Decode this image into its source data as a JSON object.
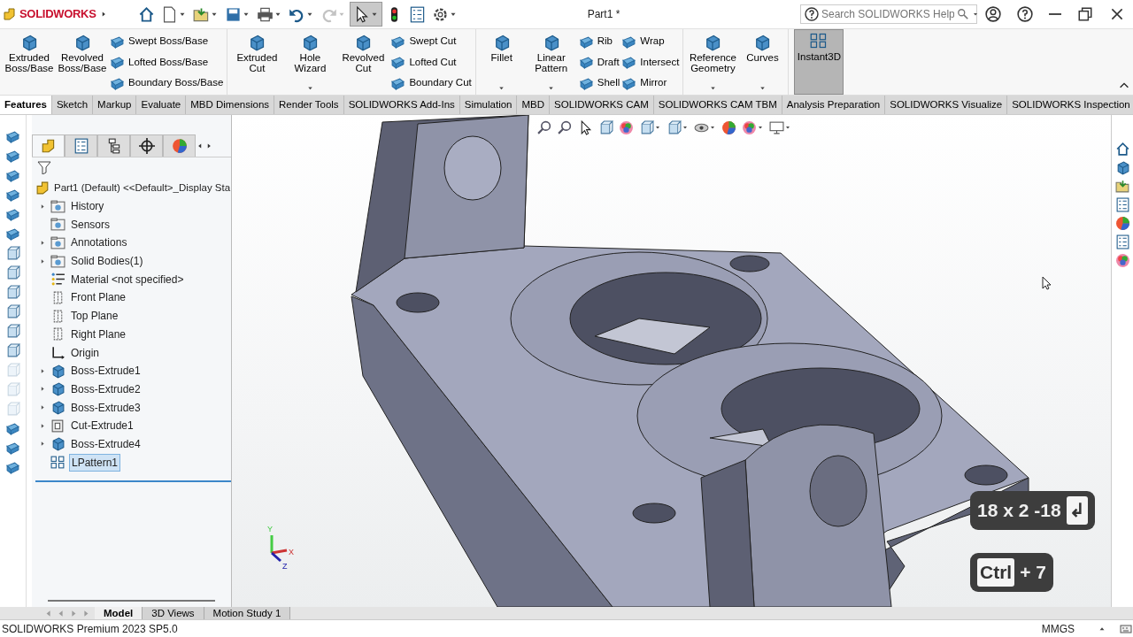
{
  "title_bar": {
    "logo": "SOLIDWORKS",
    "document_title": "Part1 *",
    "search": {
      "placeholder": "Search SOLIDWORKS Help"
    }
  },
  "quick_access": [
    {
      "kind": "home",
      "dropdown": false,
      "active": false,
      "disabled": false
    },
    {
      "kind": "new",
      "dropdown": true,
      "active": false,
      "disabled": false
    },
    {
      "kind": "open",
      "dropdown": true,
      "active": false,
      "disabled": false
    },
    {
      "kind": "save",
      "dropdown": true,
      "active": false,
      "disabled": false
    },
    {
      "kind": "print",
      "dropdown": true,
      "active": false,
      "disabled": false
    },
    {
      "kind": "undo",
      "dropdown": true,
      "active": false,
      "disabled": false
    },
    {
      "kind": "redo",
      "dropdown": true,
      "active": false,
      "disabled": true
    },
    {
      "kind": "select",
      "dropdown": true,
      "active": true,
      "disabled": false
    },
    {
      "kind": "rebuild",
      "dropdown": false,
      "active": false,
      "disabled": false
    },
    {
      "kind": "list",
      "dropdown": false,
      "active": false,
      "disabled": false
    },
    {
      "kind": "gear",
      "dropdown": true,
      "active": false,
      "disabled": false
    }
  ],
  "ribbon": {
    "groups": [
      {
        "columns": [
          {
            "kind": "large",
            "label": "Extruded Boss/Base",
            "dropdown": false
          },
          {
            "kind": "large",
            "label": "Revolved Boss/Base",
            "dropdown": false
          },
          {
            "kind": "stack",
            "items": [
              "Swept Boss/Base",
              "Lofted Boss/Base",
              "Boundary Boss/Base"
            ]
          }
        ]
      },
      {
        "columns": [
          {
            "kind": "large",
            "label": "Extruded Cut",
            "dropdown": false
          },
          {
            "kind": "large",
            "label": "Hole Wizard",
            "dropdown": true
          },
          {
            "kind": "large",
            "label": "Revolved Cut",
            "dropdown": false
          },
          {
            "kind": "stack",
            "items": [
              "Swept Cut",
              "Lofted Cut",
              "Boundary Cut"
            ]
          }
        ]
      },
      {
        "columns": [
          {
            "kind": "large",
            "label": "Fillet",
            "dropdown": true
          },
          {
            "kind": "large",
            "label": "Linear Pattern",
            "dropdown": true
          },
          {
            "kind": "stack",
            "items": [
              "Rib",
              "Draft",
              "Shell"
            ]
          },
          {
            "kind": "stack",
            "items": [
              "Wrap",
              "Intersect",
              "Mirror"
            ]
          }
        ]
      },
      {
        "columns": [
          {
            "kind": "large",
            "label": "Reference Geometry",
            "dropdown": true
          },
          {
            "kind": "large",
            "label": "Curves",
            "dropdown": true
          }
        ]
      }
    ],
    "toggle": {
      "label": "Instant3D",
      "on": true
    }
  },
  "tabs": [
    {
      "label": "Features",
      "selected": true
    },
    {
      "label": "Sketch",
      "selected": false
    },
    {
      "label": "Markup",
      "selected": false
    },
    {
      "label": "Evaluate",
      "selected": false
    },
    {
      "label": "MBD Dimensions",
      "selected": false
    },
    {
      "label": "Render Tools",
      "selected": false
    },
    {
      "label": "SOLIDWORKS Add-Ins",
      "selected": false
    },
    {
      "label": "Simulation",
      "selected": false
    },
    {
      "label": "MBD",
      "selected": false
    },
    {
      "label": "SOLIDWORKS CAM",
      "selected": false
    },
    {
      "label": "SOLIDWORKS CAM TBM",
      "selected": false
    },
    {
      "label": "Analysis Preparation",
      "selected": false
    },
    {
      "label": "SOLIDWORKS Visualize",
      "selected": false
    },
    {
      "label": "SOLIDWORKS Inspection",
      "selected": false
    }
  ],
  "feature_tree": {
    "panel_tabs": [
      {
        "selected": true
      },
      {
        "selected": false
      },
      {
        "selected": false
      },
      {
        "selected": false
      },
      {
        "selected": false
      }
    ],
    "root": "Part1 (Default) <<Default>_Display Sta",
    "items": [
      {
        "label": "History",
        "kind": "folder",
        "has_children": true,
        "selected": false
      },
      {
        "label": "Sensors",
        "kind": "folder",
        "has_children": false,
        "selected": false
      },
      {
        "label": "Annotations",
        "kind": "folder",
        "has_children": true,
        "selected": false
      },
      {
        "label": "Solid Bodies(1)",
        "kind": "folder",
        "has_children": true,
        "selected": false
      },
      {
        "label": "Material <not specified>",
        "kind": "material",
        "has_children": false,
        "selected": false
      },
      {
        "label": "Front Plane",
        "kind": "plane",
        "has_children": false,
        "selected": false
      },
      {
        "label": "Top Plane",
        "kind": "plane",
        "has_children": false,
        "selected": false
      },
      {
        "label": "Right Plane",
        "kind": "plane",
        "has_children": false,
        "selected": false
      },
      {
        "label": "Origin",
        "kind": "origin",
        "has_children": false,
        "selected": false
      },
      {
        "label": "Boss-Extrude1",
        "kind": "boss",
        "has_children": true,
        "selected": false
      },
      {
        "label": "Boss-Extrude2",
        "kind": "boss",
        "has_children": true,
        "selected": false
      },
      {
        "label": "Boss-Extrude3",
        "kind": "boss",
        "has_children": true,
        "selected": false
      },
      {
        "label": "Cut-Extrude1",
        "kind": "cut",
        "has_children": true,
        "selected": false
      },
      {
        "label": "Boss-Extrude4",
        "kind": "boss",
        "has_children": true,
        "selected": false
      },
      {
        "label": "LPattern1",
        "kind": "pattern",
        "has_children": false,
        "selected": true
      }
    ]
  },
  "triad": {
    "y": "Y",
    "x": "X",
    "z": "Z"
  },
  "keystrokes": [
    {
      "parts": [
        {
          "kind": "text",
          "text": "18 x 2 -18"
        },
        {
          "kind": "key",
          "text": "↲"
        }
      ]
    },
    {
      "parts": [
        {
          "kind": "key",
          "text": "Ctrl"
        },
        {
          "kind": "text",
          "text": "+ 7"
        }
      ]
    }
  ],
  "bottom_tabs": [
    {
      "label": "Model",
      "selected": true
    },
    {
      "label": "3D Views",
      "selected": false
    },
    {
      "label": "Motion Study 1",
      "selected": false
    }
  ],
  "status_bar": {
    "product": "SOLIDWORKS Premium 2023 SP5.0",
    "units": "MMGS"
  }
}
